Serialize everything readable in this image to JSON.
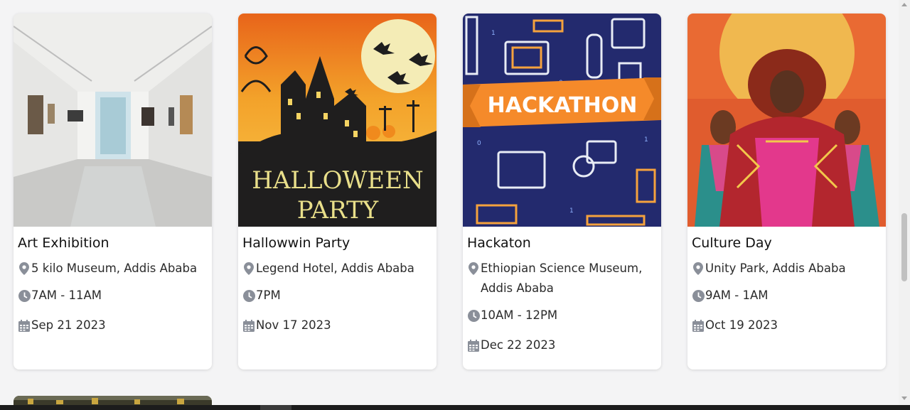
{
  "events": [
    {
      "title": "Art Exhibition",
      "location": "5 kilo Museum, Addis Ababa",
      "time": "7AM - 11AM",
      "date": "Sep 21 2023",
      "image": "art-gallery-image"
    },
    {
      "title": "Hallowwin Party",
      "location": "Legend Hotel, Addis Ababa",
      "time": "7PM",
      "date": "Nov 17 2023",
      "image": "halloween-party-image",
      "image_text_line1": "HALLOWEEN",
      "image_text_line2": "PARTY"
    },
    {
      "title": "Hackaton",
      "location": "Ethiopian Science Museum, Addis Ababa",
      "time": "10AM - 12PM",
      "date": "Dec 22 2023",
      "image": "hackathon-image",
      "image_text": "HACKATHON"
    },
    {
      "title": "Culture Day",
      "location": "Unity Park, Addis Ababa",
      "time": "9AM - 1AM",
      "date": "Oct 19 2023",
      "image": "culture-day-image"
    }
  ],
  "icons": {
    "location": "map-pin-icon",
    "time": "clock-icon",
    "date": "calendar-icon"
  },
  "colors": {
    "page_bg": "#f4f4f5",
    "card_bg": "#ffffff",
    "icon": "#8a8f99",
    "halloween_orange": "#f08a1d",
    "hackathon_navy": "#232a6e",
    "hackathon_orange": "#f58a2a"
  }
}
